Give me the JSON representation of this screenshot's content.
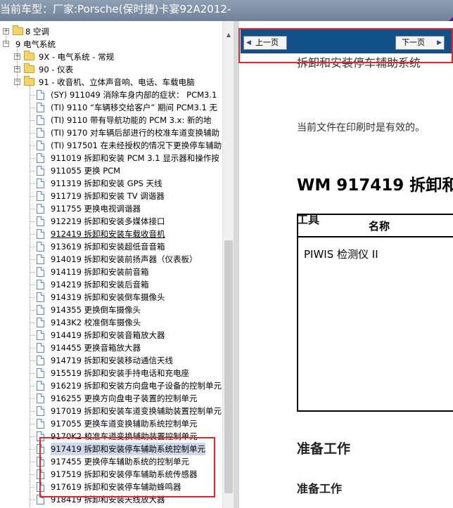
{
  "window": {
    "title": "当前车型：厂家:Porsche(保时捷)卡宴92A2012-"
  },
  "tree": {
    "nodes": [
      {
        "label": "8 空调",
        "level": 1,
        "icon": "folder-icon",
        "expander": "+"
      },
      {
        "label": "9 电气系统",
        "level": 1,
        "icon": "none",
        "expander": "−"
      },
      {
        "label": "9X - 电气系统 - 常规",
        "level": 2,
        "icon": "folder-icon",
        "expander": "+"
      },
      {
        "label": "90 - 仪表",
        "level": 2,
        "icon": "folder-icon",
        "expander": "+"
      },
      {
        "label": "91 - 收音机、立体声音响、电话、车载电脑",
        "level": 2,
        "icon": "folder-icon",
        "expander": "−"
      },
      {
        "label": "(SY) 911049 消除车身内部的症状：  PCM3.1",
        "level": 3,
        "icon": "document-icon"
      },
      {
        "label": "(TI) 9110 “车辆移交给客户” 期间  PCM3.1 无",
        "level": 3,
        "icon": "document-icon"
      },
      {
        "label": "(TI) 9110 带有导航功能的  PCM 3.x:   新的地",
        "level": 3,
        "icon": "document-icon"
      },
      {
        "label": "(TI) 9170 对车辆后部进行的校准车道变换辅助",
        "level": 3,
        "icon": "document-icon"
      },
      {
        "label": "(TI) 917501 在未经授权的情况下更换停车辅助",
        "level": 3,
        "icon": "document-icon"
      },
      {
        "label": "911019 拆卸和安装  PCM 3.1 显示器和操作按",
        "level": 3,
        "icon": "document-icon"
      },
      {
        "label": "911055 更换  PCM",
        "level": 3,
        "icon": "document-icon"
      },
      {
        "label": "911319 拆卸和安装  GPS 天线",
        "level": 3,
        "icon": "document-icon"
      },
      {
        "label": "911719 拆卸和安装  TV 调谐器",
        "level": 3,
        "icon": "document-icon"
      },
      {
        "label": "911755 更换电视调谐器",
        "level": 3,
        "icon": "document-icon"
      },
      {
        "label": "912219 拆卸和安装多媒体接口",
        "level": 3,
        "icon": "document-icon"
      },
      {
        "label": "912419 拆卸和安装车载收音机",
        "level": 3,
        "icon": "document-icon",
        "underlined": true
      },
      {
        "label": "913619 拆卸和安装超低音音箱",
        "level": 3,
        "icon": "document-icon"
      },
      {
        "label": "914019 拆卸和安装前扬声器（仪表板）",
        "level": 3,
        "icon": "document-icon"
      },
      {
        "label": "914119 拆卸和安装前音箱",
        "level": 3,
        "icon": "document-icon"
      },
      {
        "label": "914219 拆卸和安装后音箱",
        "level": 3,
        "icon": "document-icon"
      },
      {
        "label": "914319 拆卸和安装倒车摄像头",
        "level": 3,
        "icon": "document-icon"
      },
      {
        "label": "914355 更换倒车摄像头",
        "level": 3,
        "icon": "document-icon"
      },
      {
        "label": "9143K2 校准倒车摄像头",
        "level": 3,
        "icon": "document-icon"
      },
      {
        "label": "914419 拆卸和安装音箱放大器",
        "level": 3,
        "icon": "document-icon"
      },
      {
        "label": "914455 更换音箱放大器",
        "level": 3,
        "icon": "document-icon"
      },
      {
        "label": "914719 拆卸和安装移动通信天线",
        "level": 3,
        "icon": "document-icon"
      },
      {
        "label": "915519 拆卸和安装手持电话和充电座",
        "level": 3,
        "icon": "document-icon"
      },
      {
        "label": "916219 拆卸和安装方向盘电子设备的控制单元",
        "level": 3,
        "icon": "document-icon"
      },
      {
        "label": "916255 更换方向盘电子装置的控制单元",
        "level": 3,
        "icon": "document-icon"
      },
      {
        "label": "917019 拆卸和安装车道变换辅助装置控制单元",
        "level": 3,
        "icon": "document-icon"
      },
      {
        "label": "917055 更换车道变换辅助系统控制单元",
        "level": 3,
        "icon": "document-icon"
      },
      {
        "label": "9170K2 校准车道变换辅助装置控制单元",
        "level": 3,
        "icon": "document-icon"
      },
      {
        "label": "917419 拆卸和安装停车辅助系统控制单元",
        "level": 3,
        "icon": "document-icon",
        "selected": true
      },
      {
        "label": "917455 更换停车辅助系统的控制单元",
        "level": 3,
        "icon": "document-icon"
      },
      {
        "label": "917519 拆卸和安装停车辅助系统传感器",
        "level": 3,
        "icon": "document-icon"
      },
      {
        "label": "917619 拆卸和安装停车辅助蜂鸣器",
        "level": 3,
        "icon": "document-icon"
      },
      {
        "label": "918419 拆卸和安装天线放大器",
        "level": 3,
        "icon": "document-icon"
      }
    ]
  },
  "nav": {
    "prev_label": "上一页",
    "next_label": "下一页",
    "prev_icon": "arrow-left-icon",
    "next_icon": "arrow-right-icon"
  },
  "document": {
    "heading_top": "拆卸和安装停车辅助系统",
    "validity_note": "当前文件在印刷时是有效的。",
    "wm_title": "WM 917419 拆卸和",
    "tools_heading": "工具",
    "tools_table": {
      "columns": [
        "名称"
      ],
      "rows": [
        [
          "PIWIS 检测仪  II"
        ]
      ]
    },
    "prep_heading": "准备工作",
    "prep_subheading": "准备工作"
  },
  "colors": {
    "nav_bar": "#11518a",
    "highlight_box": "#e8242b",
    "selected_row": "#cfd9e8"
  }
}
